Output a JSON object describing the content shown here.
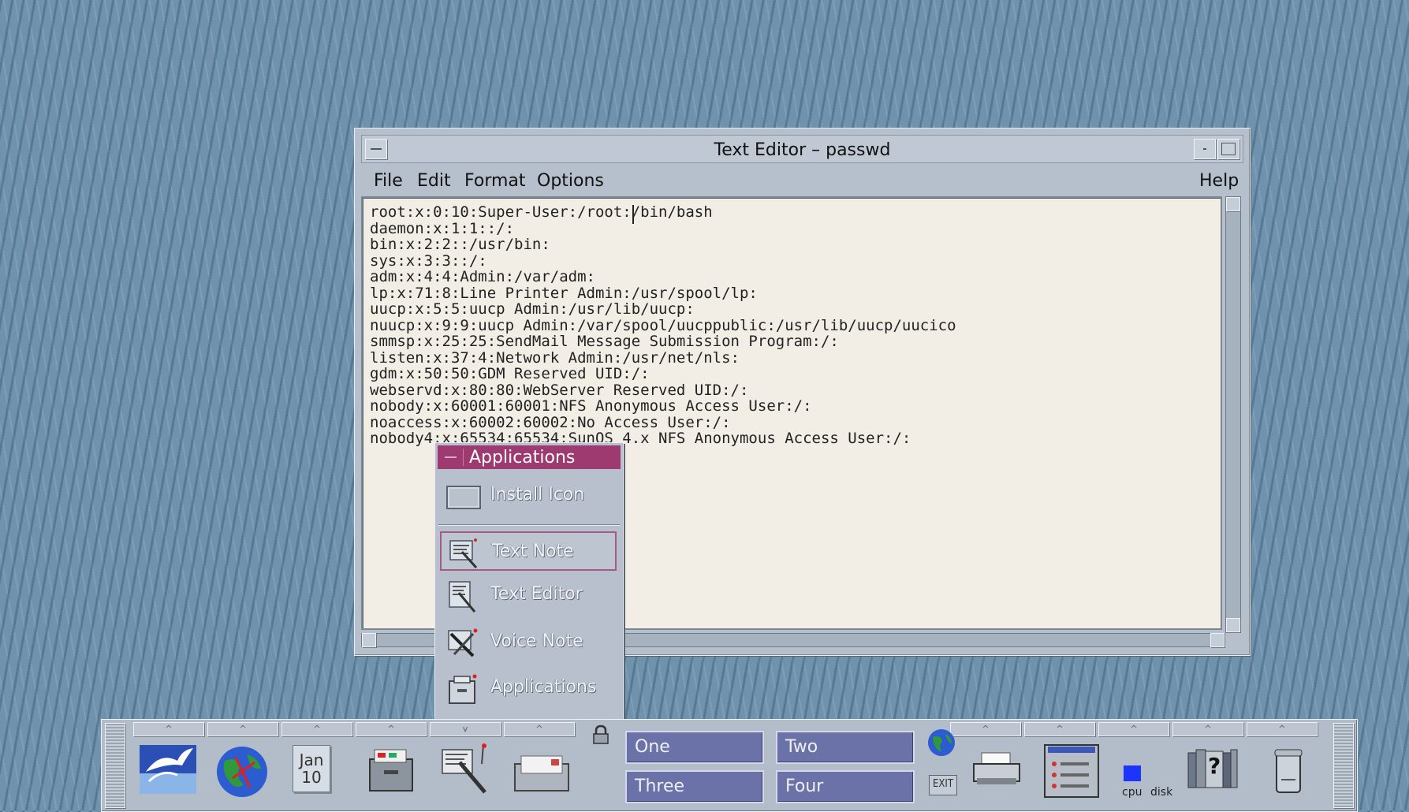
{
  "editor": {
    "title": "Text Editor – passwd",
    "menu": {
      "file": "File",
      "edit": "Edit",
      "format": "Format",
      "options": "Options",
      "help": "Help"
    },
    "content": "root:x:0:10:Super-User:/root:/bin/bash\ndaemon:x:1:1::/:\nbin:x:2:2::/usr/bin:\nsys:x:3:3::/:\nadm:x:4:4:Admin:/var/adm:\nlp:x:71:8:Line Printer Admin:/usr/spool/lp:\nuucp:x:5:5:uucp Admin:/usr/lib/uucp:\nnuucp:x:9:9:uucp Admin:/var/spool/uucppublic:/usr/lib/uucp/uucico\nsmmsp:x:25:25:SendMail Message Submission Program:/:\nlisten:x:37:4:Network Admin:/usr/net/nls:\ngdm:x:50:50:GDM Reserved UID:/:\nwebservd:x:80:80:WebServer Reserved UID:/:\nnobody:x:60001:60001:NFS Anonymous Access User:/:\nnoaccess:x:60002:60002:No Access User:/:\nnobody4:x:65534:65534:SunOS 4.x NFS Anonymous Access User:/:"
  },
  "applications_menu": {
    "title": "Applications",
    "items": [
      {
        "label": "Install Icon",
        "icon": "install-icon"
      },
      {
        "label": "Text Note",
        "icon": "text-note-icon"
      },
      {
        "label": "Text Editor",
        "icon": "text-editor-icon"
      },
      {
        "label": "Voice Note",
        "icon": "voice-note-icon"
      },
      {
        "label": "Applications",
        "icon": "applications-icon"
      }
    ]
  },
  "front_panel": {
    "calendar": {
      "month": "Jan",
      "day": "10"
    },
    "workspaces": [
      "One",
      "Two",
      "Three",
      "Four"
    ],
    "exit_label": "EXIT",
    "cpu_label": "cpu",
    "disk_label": "disk",
    "help_label": "?",
    "colors": {
      "workspace": "#6b72a8",
      "menu_title": "#9f3a71",
      "cpu_indicator": "#1b35ff"
    }
  }
}
